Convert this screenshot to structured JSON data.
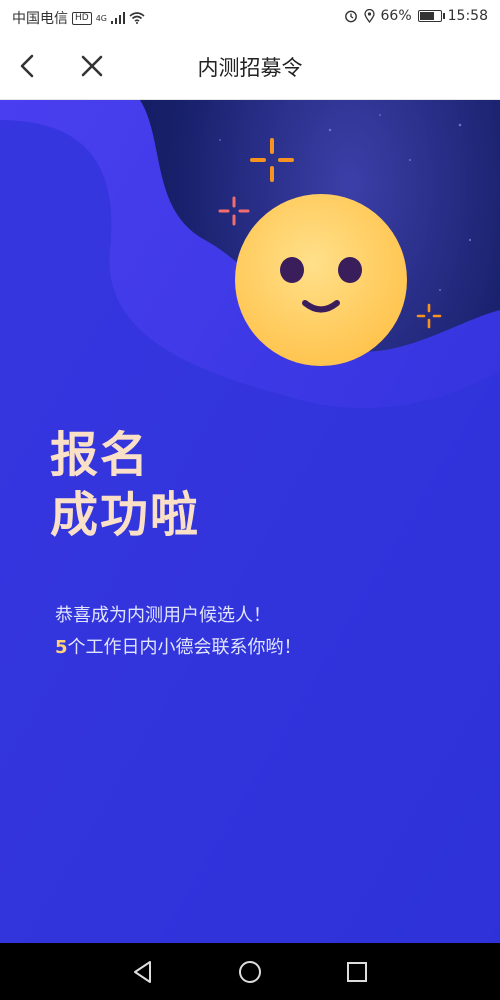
{
  "status_bar": {
    "carrier": "中国电信",
    "hd_badge": "HD",
    "network": "4G",
    "battery_percent": "66%",
    "battery_level": 0.66,
    "time": "15:58"
  },
  "nav": {
    "title": "内测招募令"
  },
  "main": {
    "headline_line1": "报名",
    "headline_line2": "成功啦",
    "message_line1": "恭喜成为内测用户候选人！",
    "message_line2_number": "5",
    "message_line2_rest": "个工作日内小德会联系你哟！"
  },
  "colors": {
    "accent_orange": "#f7931e",
    "accent_pink": "#f26d6d",
    "face_yellow": "#ffd66b",
    "background_blue": "#2b2fd6"
  },
  "icons": {
    "back": "chevron-left",
    "close": "x",
    "sys_back": "triangle-left",
    "sys_home": "circle",
    "sys_recent": "square"
  }
}
